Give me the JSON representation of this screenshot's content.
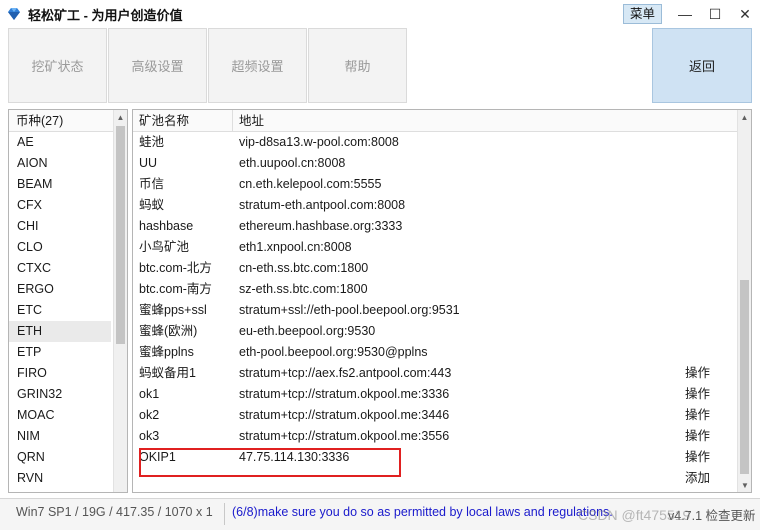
{
  "window": {
    "title": "轻松矿工 - 为用户创造价值",
    "menu_label": "菜单",
    "minimize_glyph": "—",
    "maximize_glyph": "☐",
    "close_glyph": "✕"
  },
  "toolbar": {
    "mining_status": "挖矿状态",
    "advanced_settings": "高级设置",
    "overclock_settings": "超频设置",
    "help": "帮助",
    "back": "返回"
  },
  "coins": {
    "header": "币种(27)",
    "items": [
      "AE",
      "AION",
      "BEAM",
      "CFX",
      "CHI",
      "CLO",
      "CTXC",
      "ERGO",
      "ETC",
      "ETH",
      "ETP",
      "FIRO",
      "GRIN32",
      "MOAC",
      "NIM",
      "QRN",
      "RVN"
    ],
    "selected": "ETH"
  },
  "pools": {
    "header_name": "矿池名称",
    "header_address": "地址",
    "rows": [
      {
        "name": "蛙池",
        "address": "vip-d8sa13.w-pool.com:8008",
        "op": ""
      },
      {
        "name": "UU",
        "address": "eth.uupool.cn:8008",
        "op": ""
      },
      {
        "name": "币信",
        "address": "cn.eth.kelepool.com:5555",
        "op": ""
      },
      {
        "name": "蚂蚁",
        "address": "stratum-eth.antpool.com:8008",
        "op": ""
      },
      {
        "name": "hashbase",
        "address": "ethereum.hashbase.org:3333",
        "op": ""
      },
      {
        "name": "小鸟矿池",
        "address": "eth1.xnpool.cn:8008",
        "op": ""
      },
      {
        "name": "btc.com-北方",
        "address": "cn-eth.ss.btc.com:1800",
        "op": ""
      },
      {
        "name": "btc.com-南方",
        "address": "sz-eth.ss.btc.com:1800",
        "op": ""
      },
      {
        "name": "蜜蜂pps+ssl",
        "address": "stratum+ssl://eth-pool.beepool.org:9531",
        "op": ""
      },
      {
        "name": "蜜蜂(欧洲)",
        "address": "eu-eth.beepool.org:9530",
        "op": ""
      },
      {
        "name": "蜜蜂pplns",
        "address": "eth-pool.beepool.org:9530@pplns",
        "op": ""
      },
      {
        "name": "蚂蚁备用1",
        "address": "stratum+tcp://aex.fs2.antpool.com:443",
        "op": "操作"
      },
      {
        "name": "ok1",
        "address": "stratum+tcp://stratum.okpool.me:3336",
        "op": "操作"
      },
      {
        "name": "ok2",
        "address": "stratum+tcp://stratum.okpool.me:3446",
        "op": "操作"
      },
      {
        "name": "ok3",
        "address": "stratum+tcp://stratum.okpool.me:3556",
        "op": "操作"
      },
      {
        "name": "OKIP1",
        "address": "47.75.114.130:3336",
        "op": "操作"
      },
      {
        "name": "",
        "address": "",
        "op": "添加"
      }
    ]
  },
  "statusbar": {
    "system": "Win7 SP1 / 19G / 417.35 / 1070 x 1",
    "message": "(6/8)make sure you do so as permitted by local laws and regulations.",
    "version": "v4.7.1 检查更新"
  },
  "watermark": "CSDN @ft475519",
  "colors": {
    "accent_blue": "#cfe2f3",
    "highlight_red": "#e02020",
    "status_link": "#1a1acc"
  }
}
